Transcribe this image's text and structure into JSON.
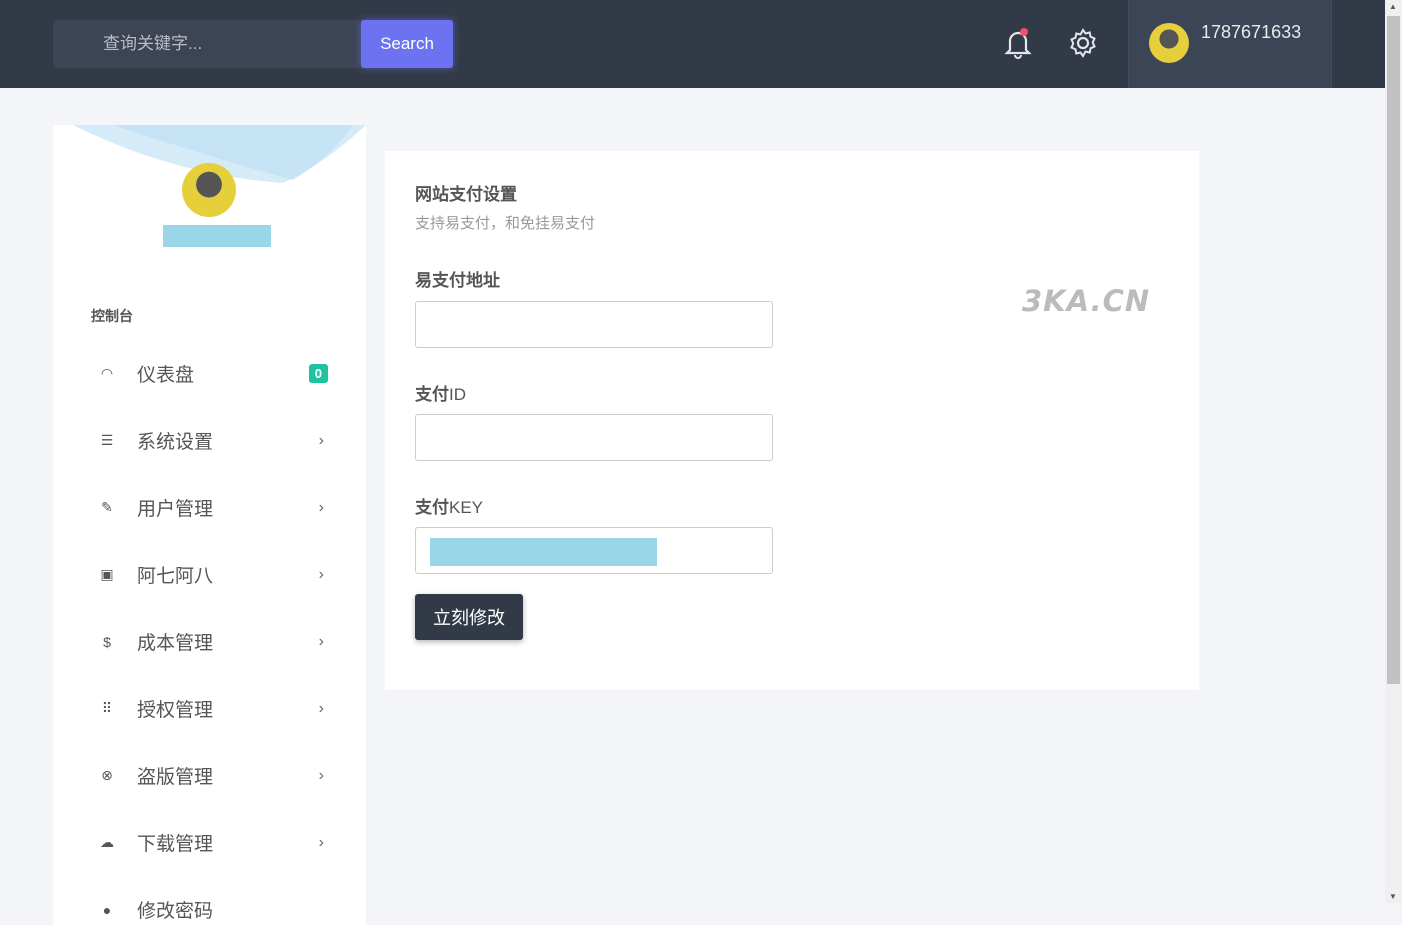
{
  "header": {
    "search_placeholder": "查询关键字...",
    "search_button": "Search",
    "username": "1787671633",
    "notification_dot_color": "#f0506e"
  },
  "sidebar": {
    "section_title": "控制台",
    "items": [
      {
        "label": "仪表盘",
        "icon": "gauge-icon",
        "badge": "0"
      },
      {
        "label": "系统设置",
        "icon": "list-icon"
      },
      {
        "label": "用户管理",
        "icon": "edit-icon"
      },
      {
        "label": "阿七阿八",
        "icon": "calendar-icon"
      },
      {
        "label": "成本管理",
        "icon": "dollar-icon"
      },
      {
        "label": "授权管理",
        "icon": "grid-icon"
      },
      {
        "label": "盗版管理",
        "icon": "close-circle-icon"
      },
      {
        "label": "下载管理",
        "icon": "cloud-download-icon"
      },
      {
        "label": "修改密码",
        "icon": "user-icon"
      }
    ]
  },
  "form": {
    "title": "网站支付设置",
    "subtitle": "支持易支付，和免挂易支付",
    "fields": [
      {
        "label": "易支付地址",
        "value": ""
      },
      {
        "label_cn": "支付",
        "label_en": "ID",
        "value": ""
      },
      {
        "label_cn": "支付",
        "label_en": "KEY",
        "value": ""
      }
    ],
    "submit": "立刻修改",
    "watermark": "3KA.CN"
  }
}
